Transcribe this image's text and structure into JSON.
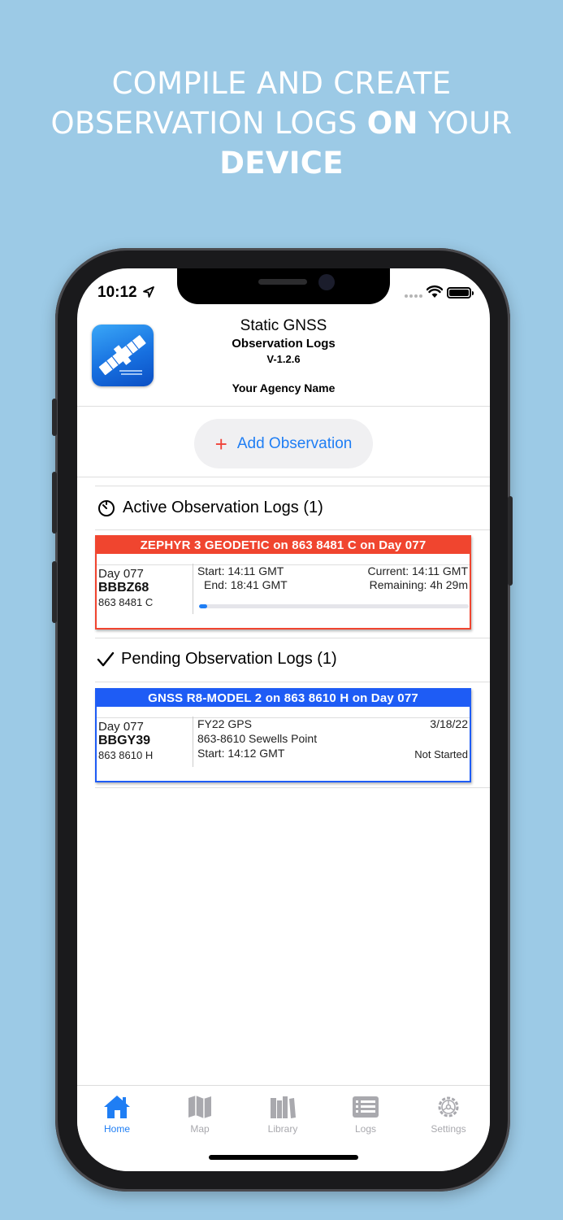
{
  "headline": {
    "line1": "COMPILE AND CREATE",
    "line2_pre": "OBSERVATION LOGS ",
    "line2_bold": "ON",
    "line2_post": " YOUR",
    "line3_bold": "DEVICE"
  },
  "status_bar": {
    "time": "10:12"
  },
  "header": {
    "app_name": "Static GNSS",
    "subtitle": "Observation Logs",
    "version": "V-1.2.6",
    "agency": "Your Agency Name"
  },
  "add_observation": {
    "label": "Add Observation",
    "plus": "+"
  },
  "active_section": {
    "title": "Active Observation Logs (1)",
    "card": {
      "banner": "ZEPHYR 3 GEODETIC on 863 8481 C on Day 077",
      "banner_color": "#f0452f",
      "day": "Day 077",
      "code": "BBBZ68",
      "mark": "863 8481 C",
      "start": "Start: 14:11 GMT",
      "end": "End: 18:41 GMT",
      "current": "Current: 14:11 GMT",
      "remaining": "Remaining: 4h 29m",
      "progress_percent": 3
    }
  },
  "pending_section": {
    "title": "Pending Observation Logs (1)",
    "card": {
      "banner": "GNSS R8-MODEL 2 on 863 8610 H on Day 077",
      "banner_color": "#1e5cf5",
      "day": "Day 077",
      "code": "BBGY39",
      "mark": "863 8610 H",
      "project": "FY22 GPS",
      "station": "863-8610 Sewells Point",
      "start": "Start: 14:12 GMT",
      "date": "3/18/22",
      "status": "Not Started"
    }
  },
  "tab_bar": {
    "items": [
      {
        "label": "Home",
        "icon": "home-icon",
        "active": true
      },
      {
        "label": "Map",
        "icon": "map-icon",
        "active": false
      },
      {
        "label": "Library",
        "icon": "library-icon",
        "active": false
      },
      {
        "label": "Logs",
        "icon": "logs-icon",
        "active": false
      },
      {
        "label": "Settings",
        "icon": "gear-icon",
        "active": false
      }
    ]
  },
  "colors": {
    "accent": "#1f7ef4",
    "background": "#9ccae6",
    "active_red": "#f0452f",
    "pending_blue": "#1e5cf5"
  }
}
